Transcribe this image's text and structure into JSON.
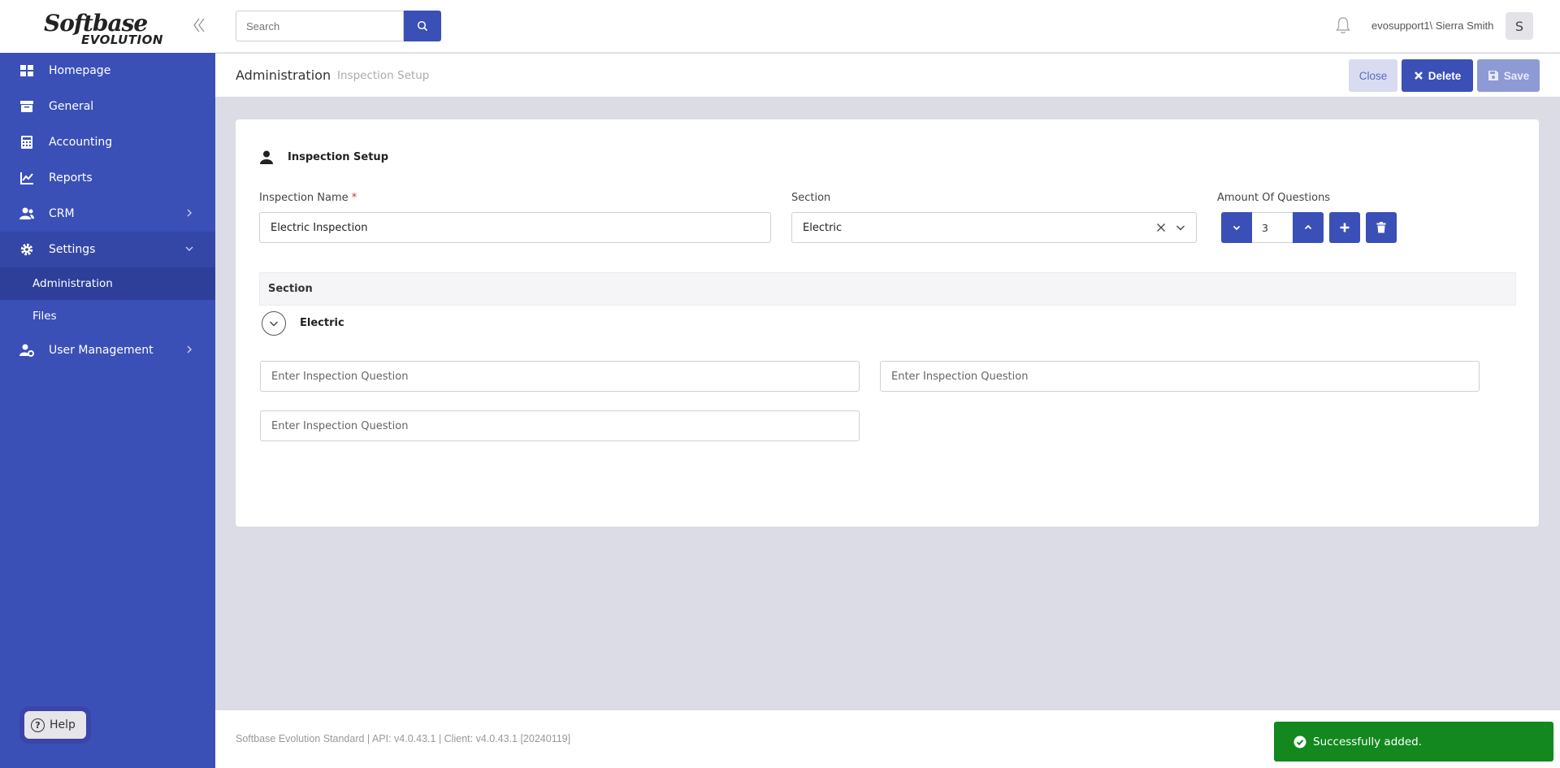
{
  "brand": {
    "line1": "Softbase",
    "line2": "EVOLUTION"
  },
  "sidebar": {
    "items": [
      {
        "label": "Homepage",
        "icon": "grid-icon"
      },
      {
        "label": "General",
        "icon": "archive-box-icon"
      },
      {
        "label": "Accounting",
        "icon": "calculator-icon"
      },
      {
        "label": "Reports",
        "icon": "line-chart-icon"
      },
      {
        "label": "CRM",
        "icon": "users-icon"
      },
      {
        "label": "Settings",
        "icon": "gear-icon"
      },
      {
        "label": "User Management",
        "icon": "user-gear-icon"
      }
    ],
    "settings_sub": [
      {
        "label": "Administration"
      },
      {
        "label": "Files"
      }
    ],
    "help_label": "Help"
  },
  "header": {
    "search_placeholder": "Search",
    "user_label": "evosupport1\\ Sierra Smith",
    "avatar_letter": "S"
  },
  "breadcrumb": {
    "main": "Administration",
    "sub": "Inspection Setup"
  },
  "toolbar": {
    "close_label": "Close",
    "delete_label": "Delete",
    "save_label": "Save"
  },
  "form": {
    "title": "Inspection Setup",
    "inspection_name_label": "Inspection Name",
    "required_mark": "*",
    "inspection_name_value": "Electric Inspection",
    "section_label": "Section",
    "section_value": "Electric",
    "amount_label": "Amount Of Questions",
    "amount_value": "3"
  },
  "section_table": {
    "header": "Section",
    "name": "Electric",
    "question_placeholder": "Enter Inspection Question",
    "question_count": 3
  },
  "footer": {
    "text": "Softbase Evolution Standard | API: v4.0.43.1 | Client: v4.0.43.1 [20240119]"
  },
  "toast": {
    "message": "Successfully added."
  },
  "colors": {
    "primary": "#3a50b7",
    "success": "#12881f",
    "background": "#dcdce6"
  }
}
